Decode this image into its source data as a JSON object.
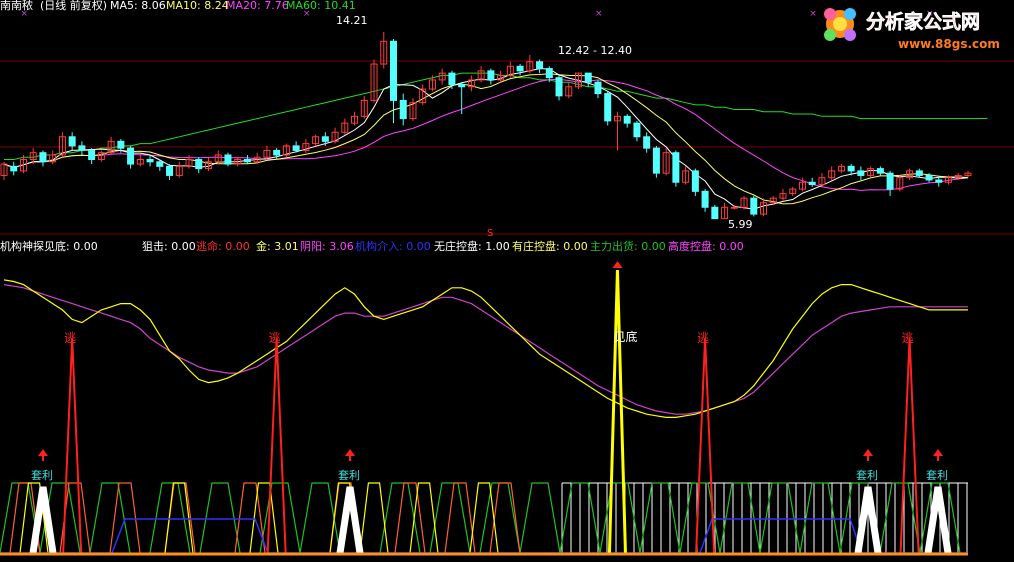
{
  "colors": {
    "bg": "#000000",
    "up": "#ff3c3c",
    "down": "#54ffff",
    "ma5": "#ffffff",
    "ma10": "#ffff66",
    "ma20": "#ff44ff",
    "ma60": "#22dd22",
    "grid": "#7a0000",
    "yellow": "#ffff00",
    "red": "#ff2020",
    "purple": "#cc44cc",
    "blue": "#3030ff",
    "green": "#20c020",
    "white": "#ffffff",
    "cyan": "#40e0e0"
  },
  "header": {
    "stock_name": "南南秾",
    "period_info": "(日线 前复权)",
    "ma5": "MA5: 8.06",
    "ma10": "MA10: 8.24",
    "ma20": "MA20: 7.76",
    "ma60": "MA60: 10.41"
  },
  "logo": {
    "brand": "分析家公式网",
    "url": "www.88gs.com"
  },
  "price_labels": {
    "high": "14.21",
    "mid": "12.42 - 12.40",
    "low": "5.99",
    "marker": "S"
  },
  "indicator": {
    "items": [
      {
        "label": "机构神探",
        "color": "#ffffff"
      },
      {
        "label": "见底: 0.00",
        "color": "#ffffff"
      },
      {
        "label": "狙击: 0.00",
        "color": "#ffffff"
      },
      {
        "label": "逃命: 0.00",
        "color": "#ff3030"
      },
      {
        "label": "金: 3.01",
        "color": "#ffff66"
      },
      {
        "label": "阴阳: 3.06",
        "color": "#ff44ff"
      },
      {
        "label": "机构介入: 0.00",
        "color": "#3030ff"
      },
      {
        "label": "无庄控盘: 1.00",
        "color": "#ffffff"
      },
      {
        "label": "有庄控盘: 0.00",
        "color": "#ffff66"
      },
      {
        "label": "主力出货: 0.00",
        "color": "#20c020"
      },
      {
        "label": "高度控盘: 0.00",
        "color": "#ff44ff"
      }
    ],
    "text_tao": "逃",
    "text_jiandi": "见底",
    "text_taoli": "套利"
  },
  "chart_data": {
    "type": "line",
    "price_panel": {
      "candles": [
        [
          7.9,
          8.4,
          7.7,
          8.5
        ],
        [
          8.3,
          8.1,
          7.9,
          8.5
        ],
        [
          8.1,
          8.6,
          8.0,
          8.8
        ],
        [
          8.6,
          8.9,
          8.4,
          9.1
        ],
        [
          8.9,
          8.5,
          8.3,
          9.0
        ],
        [
          8.5,
          8.8,
          8.4,
          9.0
        ],
        [
          8.8,
          9.6,
          8.7,
          9.8
        ],
        [
          9.6,
          9.2,
          9.0,
          9.8
        ],
        [
          9.2,
          9.0,
          8.8,
          9.4
        ],
        [
          9.0,
          8.6,
          8.4,
          9.1
        ],
        [
          8.6,
          8.9,
          8.5,
          9.0
        ],
        [
          8.9,
          9.4,
          8.8,
          9.6
        ],
        [
          9.4,
          9.1,
          8.9,
          9.5
        ],
        [
          9.1,
          8.4,
          8.2,
          9.2
        ],
        [
          8.4,
          8.6,
          8.3,
          8.8
        ],
        [
          8.6,
          8.5,
          8.3,
          8.8
        ],
        [
          8.5,
          8.3,
          8.1,
          8.6
        ],
        [
          8.3,
          7.9,
          7.7,
          8.4
        ],
        [
          7.9,
          8.3,
          7.8,
          8.5
        ],
        [
          8.3,
          8.6,
          8.2,
          8.8
        ],
        [
          8.6,
          8.2,
          8.0,
          8.7
        ],
        [
          8.2,
          8.5,
          8.1,
          8.7
        ],
        [
          8.5,
          8.8,
          8.4,
          9.0
        ],
        [
          8.8,
          8.4,
          8.3,
          8.9
        ],
        [
          8.4,
          8.6,
          8.3,
          8.7
        ],
        [
          8.6,
          8.5,
          8.4,
          8.8
        ],
        [
          8.5,
          8.7,
          8.4,
          8.9
        ],
        [
          8.7,
          9.0,
          8.6,
          9.2
        ],
        [
          9.0,
          8.8,
          8.6,
          9.1
        ],
        [
          8.8,
          9.2,
          8.7,
          9.3
        ],
        [
          9.2,
          9.0,
          8.9,
          9.4
        ],
        [
          9.0,
          9.3,
          8.9,
          9.5
        ],
        [
          9.3,
          9.6,
          9.2,
          9.7
        ],
        [
          9.6,
          9.4,
          9.2,
          9.8
        ],
        [
          9.4,
          9.8,
          9.3,
          10.0
        ],
        [
          9.8,
          10.2,
          9.7,
          10.4
        ],
        [
          10.2,
          10.5,
          10.1,
          10.7
        ],
        [
          10.5,
          11.2,
          10.4,
          11.4
        ],
        [
          11.2,
          12.8,
          11.1,
          13.0
        ],
        [
          12.8,
          13.8,
          12.6,
          14.21
        ],
        [
          13.8,
          11.2,
          10.2,
          13.9
        ],
        [
          11.2,
          10.4,
          10.1,
          11.5
        ],
        [
          10.4,
          11.1,
          10.3,
          11.3
        ],
        [
          11.1,
          11.7,
          11.0,
          11.9
        ],
        [
          11.7,
          12.1,
          11.6,
          12.3
        ],
        [
          12.1,
          12.4,
          11.9,
          12.6
        ],
        [
          12.4,
          11.9,
          11.7,
          12.5
        ],
        [
          11.9,
          11.8,
          10.6,
          12.0
        ],
        [
          11.8,
          12.1,
          11.6,
          12.3
        ],
        [
          12.1,
          12.5,
          12.0,
          12.7
        ],
        [
          12.5,
          12.1,
          11.9,
          12.6
        ],
        [
          12.1,
          12.3,
          12.0,
          12.5
        ],
        [
          12.3,
          12.7,
          12.2,
          12.9
        ],
        [
          12.7,
          12.5,
          12.3,
          12.8
        ],
        [
          12.5,
          12.9,
          12.4,
          13.2
        ],
        [
          12.9,
          12.6,
          12.4,
          13.0
        ],
        [
          12.6,
          12.2,
          12.0,
          12.7
        ],
        [
          12.2,
          11.4,
          11.2,
          12.3
        ],
        [
          11.4,
          11.8,
          11.3,
          12.0
        ],
        [
          11.8,
          12.4,
          11.7,
          12.42
        ],
        [
          12.4,
          12.0,
          11.8,
          12.4
        ],
        [
          12.0,
          11.5,
          11.3,
          12.1
        ],
        [
          11.5,
          10.3,
          10.1,
          11.6
        ],
        [
          10.3,
          10.5,
          9.0,
          10.7
        ],
        [
          10.5,
          10.2,
          10.0,
          10.6
        ],
        [
          10.2,
          9.6,
          9.4,
          10.3
        ],
        [
          9.6,
          9.1,
          8.9,
          9.8
        ],
        [
          9.1,
          8.0,
          7.8,
          9.2
        ],
        [
          8.0,
          8.9,
          7.9,
          9.1
        ],
        [
          8.9,
          7.6,
          7.4,
          9.0
        ],
        [
          7.6,
          8.1,
          7.5,
          8.3
        ],
        [
          8.1,
          7.2,
          7.0,
          8.2
        ],
        [
          7.2,
          6.5,
          6.3,
          7.3
        ],
        [
          6.5,
          6.0,
          5.99,
          6.6
        ],
        [
          6.0,
          6.5,
          5.99,
          6.7
        ],
        [
          6.5,
          6.5,
          6.4,
          6.6
        ],
        [
          6.5,
          6.9,
          6.4,
          7.0
        ],
        [
          6.9,
          6.2,
          6.1,
          7.0
        ],
        [
          6.2,
          6.7,
          6.1,
          6.9
        ],
        [
          6.7,
          6.9,
          6.6,
          7.0
        ],
        [
          6.9,
          7.1,
          6.8,
          7.3
        ],
        [
          7.1,
          7.3,
          7.0,
          7.4
        ],
        [
          7.3,
          7.6,
          7.2,
          7.8
        ],
        [
          7.6,
          7.5,
          7.4,
          7.8
        ],
        [
          7.5,
          7.8,
          7.4,
          8.0
        ],
        [
          7.8,
          8.1,
          7.7,
          8.3
        ],
        [
          8.1,
          8.3,
          8.0,
          8.4
        ],
        [
          8.3,
          8.1,
          7.9,
          8.4
        ],
        [
          8.1,
          7.9,
          7.7,
          8.3
        ],
        [
          7.9,
          8.2,
          7.8,
          8.3
        ],
        [
          8.2,
          8.0,
          7.9,
          8.3
        ],
        [
          8.0,
          7.3,
          7.0,
          8.1
        ],
        [
          7.3,
          7.8,
          7.2,
          7.9
        ],
        [
          7.8,
          8.1,
          7.7,
          8.2
        ],
        [
          8.1,
          7.9,
          7.8,
          8.2
        ],
        [
          7.9,
          7.7,
          7.6,
          8.0
        ],
        [
          7.7,
          7.6,
          7.4,
          7.9
        ],
        [
          7.6,
          7.8,
          7.5,
          7.9
        ],
        [
          7.8,
          7.9,
          7.7,
          8.0
        ],
        [
          7.9,
          8.0,
          7.8,
          8.1
        ]
      ],
      "ma60": [
        8.6,
        8.6,
        8.7,
        8.7,
        8.8,
        8.8,
        8.9,
        8.9,
        9.0,
        9.0,
        9.1,
        9.1,
        9.2,
        9.2,
        9.3,
        9.3,
        9.4,
        9.5,
        9.6,
        9.7,
        9.8,
        9.9,
        10.0,
        10.1,
        10.2,
        10.3,
        10.4,
        10.5,
        10.6,
        10.7,
        10.8,
        10.9,
        11.0,
        11.1,
        11.2,
        11.3,
        11.4,
        11.5,
        11.6,
        11.7,
        11.8,
        11.9,
        12.0,
        12.1,
        12.2,
        12.3,
        12.3,
        12.4,
        12.4,
        12.4,
        12.4,
        12.3,
        12.3,
        12.2,
        12.2,
        12.1,
        12.1,
        12.0,
        12.0,
        11.9,
        11.8,
        11.8,
        11.7,
        11.6,
        11.6,
        11.5,
        11.4,
        11.3,
        11.3,
        11.2,
        11.1,
        11.0,
        11.0,
        10.9,
        10.9,
        10.8,
        10.8,
        10.8,
        10.7,
        10.7,
        10.7,
        10.6,
        10.6,
        10.6,
        10.5,
        10.5,
        10.5,
        10.5,
        10.4,
        10.4,
        10.4,
        10.4,
        10.4,
        10.4,
        10.4,
        10.4,
        10.4,
        10.4,
        10.4,
        10.4,
        10.4,
        10.41
      ]
    },
    "indicator_panel": {
      "ylim": [
        0,
        100
      ],
      "yellow_line": [
        95,
        94,
        92,
        88,
        84,
        80,
        76,
        70,
        68,
        72,
        76,
        78,
        80,
        80,
        76,
        70,
        60,
        50,
        45,
        38,
        32,
        30,
        31,
        33,
        36,
        40,
        44,
        48,
        52,
        56,
        62,
        68,
        74,
        80,
        86,
        90,
        86,
        78,
        72,
        70,
        72,
        74,
        76,
        78,
        82,
        86,
        90,
        90,
        88,
        84,
        78,
        72,
        66,
        60,
        54,
        48,
        44,
        40,
        36,
        32,
        28,
        24,
        20,
        17,
        14,
        12,
        10,
        9,
        8,
        8,
        9,
        10,
        12,
        14,
        16,
        18,
        22,
        28,
        36,
        44,
        54,
        64,
        72,
        80,
        86,
        90,
        92,
        92,
        90,
        88,
        86,
        84,
        82,
        80,
        78,
        76,
        76,
        76,
        76,
        76
      ],
      "purple_line": [
        92,
        91,
        90,
        88,
        86,
        84,
        82,
        80,
        78,
        76,
        74,
        72,
        70,
        68,
        64,
        58,
        54,
        50,
        46,
        43,
        40,
        38,
        37,
        36,
        36,
        38,
        40,
        44,
        48,
        52,
        56,
        60,
        64,
        68,
        72,
        74,
        74,
        72,
        72,
        72,
        74,
        76,
        78,
        80,
        82,
        84,
        84,
        82,
        80,
        76,
        72,
        68,
        64,
        60,
        56,
        52,
        48,
        44,
        40,
        36,
        32,
        28,
        25,
        22,
        19,
        16,
        14,
        12,
        11,
        10,
        10,
        11,
        12,
        14,
        16,
        18,
        20,
        24,
        30,
        36,
        42,
        48,
        54,
        60,
        64,
        68,
        72,
        74,
        75,
        76,
        77,
        78,
        78,
        78,
        78,
        78,
        78,
        78,
        78,
        78
      ]
    },
    "tao_indices": [
      7,
      28,
      72
    ],
    "jiandi_index": 63,
    "taoli_indices": [
      3,
      30,
      77,
      82
    ]
  }
}
